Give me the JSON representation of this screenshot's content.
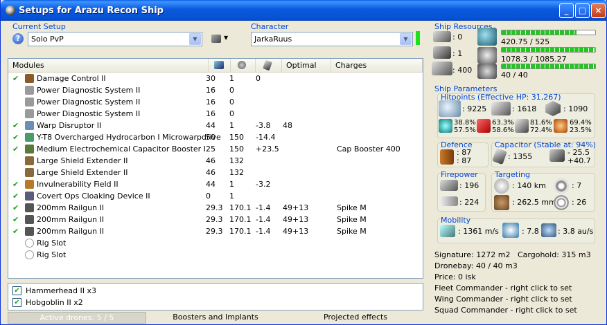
{
  "window": {
    "title": "Setups for Arazu Recon Ship",
    "buttons": [
      "_",
      "□",
      "×"
    ]
  },
  "current_setup": {
    "label": "Current Setup",
    "value": "Solo PvP"
  },
  "character": {
    "label": "Character",
    "value": "JarkaRuus"
  },
  "modules_header": {
    "name": "Modules",
    "col_optimal": "Optimal",
    "col_charges": "Charges"
  },
  "modules": [
    {
      "name": "Damage Control II",
      "active": true,
      "c1": "30",
      "c2": "1",
      "c3": "0",
      "optimal": "",
      "charges": "",
      "icon": "damage-control-icon",
      "color": "#8a5a2b"
    },
    {
      "name": "Power Diagnostic System II",
      "active": false,
      "c1": "16",
      "c2": "0",
      "c3": "",
      "optimal": "",
      "charges": "",
      "icon": "power-diagnostic-icon",
      "color": "#9a9a9a"
    },
    {
      "name": "Power Diagnostic System II",
      "active": false,
      "c1": "16",
      "c2": "0",
      "c3": "",
      "optimal": "",
      "charges": "",
      "icon": "power-diagnostic-icon",
      "color": "#9a9a9a"
    },
    {
      "name": "Power Diagnostic System II",
      "active": false,
      "c1": "16",
      "c2": "0",
      "c3": "",
      "optimal": "",
      "charges": "",
      "icon": "power-diagnostic-icon",
      "color": "#9a9a9a"
    },
    {
      "name": "Warp Disruptor II",
      "active": true,
      "c1": "44",
      "c2": "1",
      "c3": "-3.8",
      "optimal": "48",
      "charges": "",
      "icon": "warp-disruptor-icon",
      "color": "#6a8fb5"
    },
    {
      "name": "Y-T8 Overcharged Hydrocarbon I Microwarpdrive",
      "active": true,
      "c1": "50",
      "c2": "150",
      "c3": "-14.4",
      "optimal": "",
      "charges": "",
      "icon": "microwarpdrive-icon",
      "color": "#4a9a6a"
    },
    {
      "name": "Medium Electrochemical Capacitor Booster I",
      "active": true,
      "c1": "25",
      "c2": "150",
      "c3": "+23.5",
      "optimal": "",
      "charges": "Cap Booster 400",
      "icon": "capacitor-booster-icon",
      "color": "#5a7a3a"
    },
    {
      "name": "Large Shield Extender II",
      "active": false,
      "c1": "46",
      "c2": "132",
      "c3": "",
      "optimal": "",
      "charges": "",
      "icon": "shield-extender-icon",
      "color": "#8a6a3a"
    },
    {
      "name": "Large Shield Extender II",
      "active": false,
      "c1": "46",
      "c2": "132",
      "c3": "",
      "optimal": "",
      "charges": "",
      "icon": "shield-extender-icon",
      "color": "#8a6a3a"
    },
    {
      "name": "Invulnerability Field II",
      "active": true,
      "c1": "44",
      "c2": "1",
      "c3": "-3.2",
      "optimal": "",
      "charges": "",
      "icon": "invulnerability-field-icon",
      "color": "#b87a2a"
    },
    {
      "name": "Covert Ops Cloaking Device II",
      "active": true,
      "c1": "0",
      "c2": "1",
      "c3": "",
      "optimal": "",
      "charges": "",
      "icon": "cloaking-device-icon",
      "color": "#5a5a7a"
    },
    {
      "name": "200mm Railgun II",
      "active": true,
      "c1": "29.3",
      "c2": "170.1",
      "c3": "-1.4",
      "optimal": "49+13",
      "charges": "Spike M",
      "icon": "railgun-icon",
      "color": "#555555"
    },
    {
      "name": "200mm Railgun II",
      "active": true,
      "c1": "29.3",
      "c2": "170.1",
      "c3": "-1.4",
      "optimal": "49+13",
      "charges": "Spike M",
      "icon": "railgun-icon",
      "color": "#555555"
    },
    {
      "name": "200mm Railgun II",
      "active": true,
      "c1": "29.3",
      "c2": "170.1",
      "c3": "-1.4",
      "optimal": "49+13",
      "charges": "Spike M",
      "icon": "railgun-icon",
      "color": "#555555"
    },
    {
      "name": "Rig Slot",
      "active": false,
      "c1": "",
      "c2": "",
      "c3": "",
      "optimal": "",
      "charges": "",
      "icon": "rig-slot-icon",
      "color": "#ffffff"
    },
    {
      "name": "Rig Slot",
      "active": false,
      "c1": "",
      "c2": "",
      "c3": "",
      "optimal": "",
      "charges": "",
      "icon": "rig-slot-icon",
      "color": "#ffffff"
    }
  ],
  "drones": [
    {
      "name": "Hammerhead II x3",
      "checked": true
    },
    {
      "name": "Hobgoblin II x2",
      "checked": true
    }
  ],
  "bottom_tabs": {
    "active_drones": "Active drones: 5 / 5",
    "boosters": "Boosters and Implants",
    "projected": "Projected effects"
  },
  "ship_resources": {
    "label": "Ship Resources",
    "hardpoints": [
      {
        "value": ": 0"
      },
      {
        "value": ": 1"
      },
      {
        "value": ": 400"
      }
    ],
    "bars": [
      {
        "text": "420.75 / 525",
        "fill": 0.8
      },
      {
        "text": "1078.3 / 1085.27",
        "fill": 0.99
      },
      {
        "text": "40 / 40",
        "fill": 1.0
      }
    ]
  },
  "ship_parameters": {
    "label": "Ship Parameters",
    "hitpoints": {
      "label": "Hitpoints (Effective HP: 31,267)",
      "shield": ": 9225",
      "armor": ": 1618",
      "structure": ": 1090",
      "resists": [
        {
          "a": "38.8%",
          "b": "57.5%"
        },
        {
          "a": "63.3%",
          "b": "58.6%"
        },
        {
          "a": "81.6%",
          "b": "72.4%"
        },
        {
          "a": "69.4%",
          "b": "23.5%"
        }
      ]
    },
    "defence": {
      "label": "Defence",
      "v1": ": 87",
      "v2": ": 87"
    },
    "capacitor": {
      "label": "Capacitor (Stable at: 94%)",
      "amount": ": 1355",
      "delta1": "- 25.5",
      "delta2": "+40.7"
    },
    "firepower": {
      "label": "Firepower",
      "v1": ": 196",
      "v2": ": 224"
    },
    "targeting": {
      "label": "Targeting",
      "range": ": 140 km",
      "targets": ": 7",
      "resolution": ": 262.5 mm",
      "sensor": ": 26"
    },
    "mobility": {
      "label": "Mobility",
      "speed": ": 1361 m/s",
      "align": ": 7.8 s",
      "warp": ": 3.8 au/s"
    }
  },
  "stats": {
    "signature": "Signature: 1272 m2",
    "cargohold": "Cargohold: 315 m3",
    "dronebay": "Dronebay: 40 / 40 m3",
    "price": "Price: 0 isk",
    "fleet": "Fleet Commander - right click to set",
    "wing": "Wing Commander - right click to set",
    "squad": "Squad Commander - right click to set"
  }
}
